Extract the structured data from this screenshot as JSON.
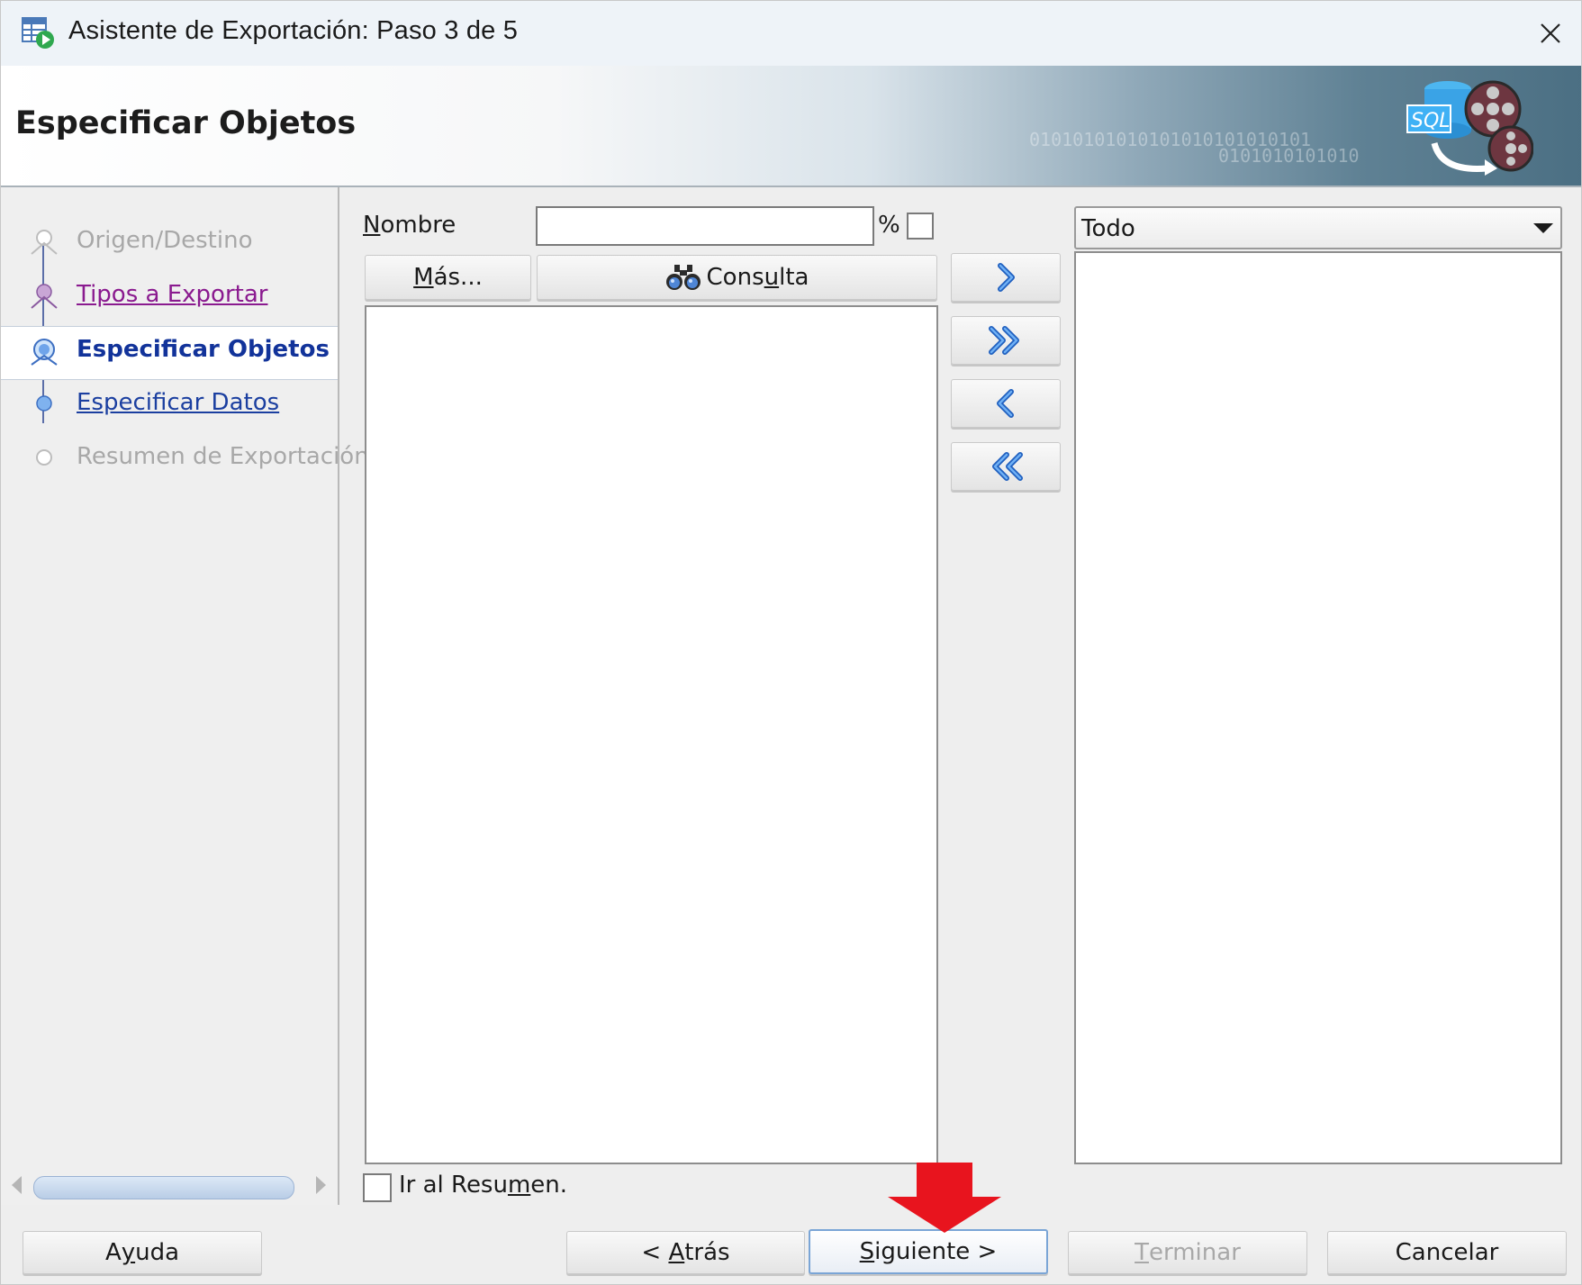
{
  "window": {
    "title": "Asistente de Exportación: Paso 3 de 5"
  },
  "banner": {
    "title": "Especificar Objetos",
    "binary_line1": "01010101010101010101010101",
    "binary_line2": "0101010101010",
    "art_text": "SQL"
  },
  "steps": [
    {
      "label": "Origen/Destino",
      "state": "disabled"
    },
    {
      "label": "Tipos a Exportar",
      "state": "visited"
    },
    {
      "label": "Especificar Objetos",
      "state": "current"
    },
    {
      "label": "Especificar Datos",
      "state": "link"
    },
    {
      "label": "Resumen de Exportación",
      "state": "disabled"
    }
  ],
  "filter": {
    "name_label_mnemonic": "N",
    "name_label_rest": "ombre",
    "name_value": "",
    "wildcard_label": "%",
    "wildcard_checked": false
  },
  "buttons": {
    "more_mnemonic": "M",
    "more_rest": "ás...",
    "query_before": "Cons",
    "query_mnemonic": "u",
    "query_after": "lta"
  },
  "available_list": [],
  "selected_list": [],
  "type_filter": {
    "selected": "Todo"
  },
  "goto_summary": {
    "before": "Ir al Resu",
    "mnemonic": "m",
    "after": "en.",
    "checked": false
  },
  "footer": {
    "help_before": "A",
    "help_mnemonic": "y",
    "help_after": "uda",
    "back_before": "< ",
    "back_mnemonic": "A",
    "back_after": "trás",
    "next_mnemonic": "S",
    "next_after": "iguiente >",
    "finish_mnemonic": "T",
    "finish_after": "erminar",
    "cancel": "Cancelar"
  },
  "colors": {
    "accent_blue": "#12339a",
    "link_blue": "#1b3fa0",
    "visited_purple": "#8a1a8f",
    "disabled_gray": "#a8a8a8",
    "annotation_red": "#e8141e"
  }
}
